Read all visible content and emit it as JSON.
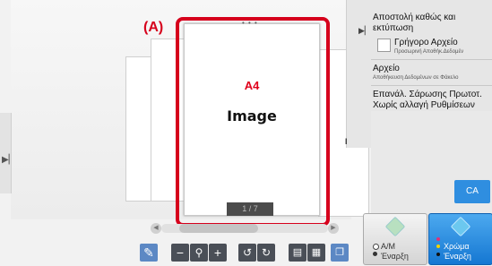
{
  "callout": "(A)",
  "preview": {
    "paper_label": "A4",
    "image_label": "Image",
    "page_counter": "1 / 7",
    "top_dots": "• • •"
  },
  "right_panel": {
    "send_print": "Αποστολή καθώς και εκτύπωση",
    "quick_file_title": "Γρήγορο Αρχείο",
    "quick_file_sub": "Προσωρινή Αποθήκ.Δεδομέν",
    "file_title": "Αρχείο",
    "file_sub": "Αποθήκευση Δεδομένων σε Φάκελο",
    "resend_title": "Επανάλ. Σάρωσης Πρωτοτ. Χωρίς αλλαγή Ρυθμίσεων",
    "edge_mark": "I"
  },
  "ca_label": "CA",
  "start_bw": {
    "line1": "A/M",
    "line2": "Έναρξη"
  },
  "start_color": {
    "line1": "Χρώμα",
    "line2": "Έναρξη"
  },
  "colors": {
    "highlight": "#d6001c",
    "accent_blue": "#2f8ee0",
    "toolbar_dark": "#4a4f57"
  },
  "toolbar_icons": [
    "edit-icon",
    "zoom-out-icon",
    "magnifier-icon",
    "zoom-in-icon",
    "rotate-left-icon",
    "rotate-right-icon",
    "single-page-icon",
    "grid-view-icon",
    "multi-page-icon"
  ]
}
